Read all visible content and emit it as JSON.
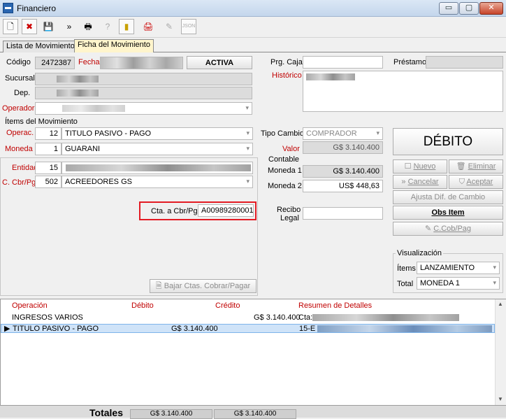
{
  "window": {
    "title": "Financiero",
    "minimize_label": "▭",
    "maximize_label": "▢",
    "close_label": "✕"
  },
  "toolbar": {
    "buttons": [
      {
        "name": "new-icon",
        "glyph": "🗋"
      },
      {
        "name": "delete-icon",
        "glyph": "✖"
      },
      {
        "name": "save-icon",
        "glyph": "💾"
      },
      {
        "name": "navigate-icon",
        "glyph": "»"
      },
      {
        "name": "print-icon",
        "glyph": "🖶"
      },
      {
        "name": "help-icon",
        "glyph": "?"
      },
      {
        "name": "exit-icon",
        "glyph": "▮"
      },
      {
        "name": "print-report-icon",
        "glyph": "🖨"
      },
      {
        "name": "stamp-icon",
        "glyph": "✎"
      },
      {
        "name": "json-icon",
        "glyph": "JSON"
      }
    ]
  },
  "tabs": [
    {
      "label": "Lista de Movimientos"
    },
    {
      "label": "Ficha del Movimiento"
    }
  ],
  "header": {
    "codigo_label": "Código",
    "codigo_value": "2472387",
    "fecha_label": "Fecha",
    "status": "ACTIVA",
    "sucursal_label": "Sucursal",
    "dep_label": "Dep.",
    "operador_label": "Operador",
    "prg_caja_label": "Prg. Caja",
    "prestamo_label": "Préstamo",
    "historico_label": "Histórico"
  },
  "items": {
    "section_label": "Ítems del Movimiento",
    "operac_label": "Operac.",
    "operac_code": "12",
    "operac_value": "TITULO PASIVO - PAGO",
    "moneda_label": "Moneda",
    "moneda_code": "1",
    "moneda_value": "GUARANI",
    "entidad_label": "Entidad",
    "entidad_code": "15",
    "ccbr_label": "C. Cbr/Pgr",
    "ccbr_code": "502",
    "ccbr_value": "ACREEDORES GS",
    "cta_label": "Cta. a Cbr/Pgr",
    "cta_value": "A00989280001",
    "bajar_label": "Bajar Ctas. Cobrar/Pagar"
  },
  "amounts": {
    "tipo_cambio_label": "Tipo Cambio",
    "tipo_cambio_value": "COMPRADOR",
    "valor_label": "Valor",
    "valor_value": "G$ 3.140.400",
    "contable_label": "Contable",
    "moneda1_label": "Moneda 1",
    "moneda1_value": "G$ 3.140.400",
    "moneda2_label": "Moneda 2",
    "moneda2_value": "US$ 448,63",
    "recibo_label": "Recibo",
    "legal_label": "Legal"
  },
  "actions": {
    "debit_label": "DÉBITO",
    "nuevo": "Nuevo",
    "eliminar": "Eliminar",
    "cancelar": "Cancelar",
    "aceptar": "Aceptar",
    "ajusta": "Ajusta Dif. de Cambio",
    "obs_item": "Obs Item",
    "ccob": "C.Cob/Pag"
  },
  "visualizacion": {
    "title": "Visualización",
    "items_label": "Ítems",
    "items_value": "LANZAMIENTO",
    "total_label": "Total",
    "total_value": "MONEDA 1"
  },
  "grid": {
    "columns": [
      "Operación",
      "Débito",
      "Crédito",
      "Resumen de Detalles"
    ],
    "rows": [
      {
        "operacion": "INGRESOS VARIOS",
        "debito": "",
        "credito": "G$ 3.140.400",
        "resumen": "Cta:"
      },
      {
        "operacion": "TITULO PASIVO - PAGO",
        "debito": "G$ 3.140.400",
        "credito": "",
        "resumen": "15-E"
      }
    ]
  },
  "totals": {
    "label": "Totales",
    "debito": "G$ 3.140.400",
    "credito": "G$ 3.140.400"
  }
}
